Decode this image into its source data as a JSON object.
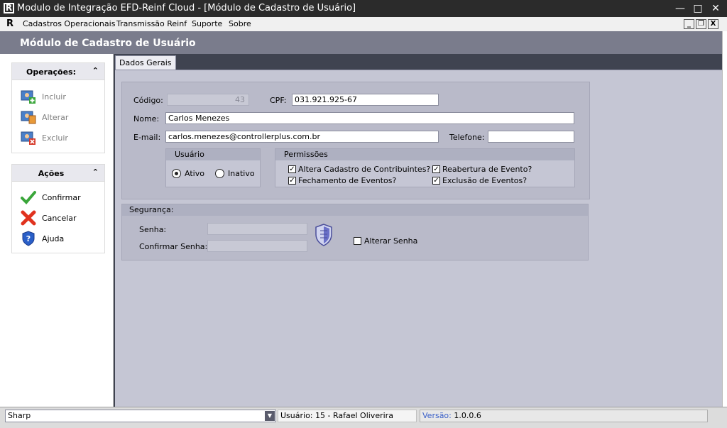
{
  "window": {
    "title": "Modulo de Integração EFD-Reinf Cloud - [Módulo de Cadastro de Usuário]",
    "logo_letter": "R"
  },
  "menubar": {
    "logo_letter": "R",
    "items": [
      "Cadastros Operacionais",
      "Transmissão Reinf",
      "Suporte",
      "Sobre"
    ]
  },
  "header": {
    "title": "Módulo de Cadastro de Usuário"
  },
  "operacoes": {
    "title": "Operações:",
    "items": [
      {
        "label": "Incluir",
        "icon": "add-user-icon"
      },
      {
        "label": "Alterar",
        "icon": "edit-user-icon"
      },
      {
        "label": "Excluir",
        "icon": "delete-user-icon"
      }
    ]
  },
  "acoes": {
    "title": "Ações",
    "items": [
      {
        "label": "Confirmar",
        "icon": "check-icon"
      },
      {
        "label": "Cancelar",
        "icon": "cross-icon"
      },
      {
        "label": "Ajuda",
        "icon": "help-shield-icon"
      }
    ]
  },
  "tab": {
    "label": "Dados Gerais"
  },
  "form": {
    "codigo_label": "Código:",
    "codigo_value": "43",
    "cpf_label": "CPF:",
    "cpf_value": "031.921.925-67",
    "nome_label": "Nome:",
    "nome_value": "Carlos Menezes",
    "email_label": "E-mail:",
    "email_value": "carlos.menezes@controllerplus.com.br",
    "telefone_label": "Telefone:",
    "telefone_value": ""
  },
  "usuario": {
    "title": "Usuário",
    "ativo": "Ativo",
    "inativo": "Inativo",
    "selected": "Ativo"
  },
  "permissoes": {
    "title": "Permissões",
    "items": [
      {
        "label": "Altera Cadastro de Contribuintes?",
        "checked": true
      },
      {
        "label": "Reabertura de Evento?",
        "checked": true
      },
      {
        "label": "Fechamento de Eventos?",
        "checked": true
      },
      {
        "label": "Exclusão de Eventos?",
        "checked": true
      }
    ]
  },
  "seguranca": {
    "title": "Segurança:",
    "senha_label": "Senha:",
    "confirmar_label": "Confirmar Senha:",
    "alterar_label": "Alterar Senha",
    "alterar_checked": false
  },
  "status": {
    "combo_value": "Sharp",
    "usuario": "Usuário: 15 - Rafael Oliverira",
    "versao_label": "Versão:",
    "versao_value": "1.0.0.6"
  },
  "colors": {
    "header": "#7a7c8c",
    "content_bg": "#3f4350",
    "panel": "#b9bac9",
    "accent_blue": "#3a5fc8"
  }
}
